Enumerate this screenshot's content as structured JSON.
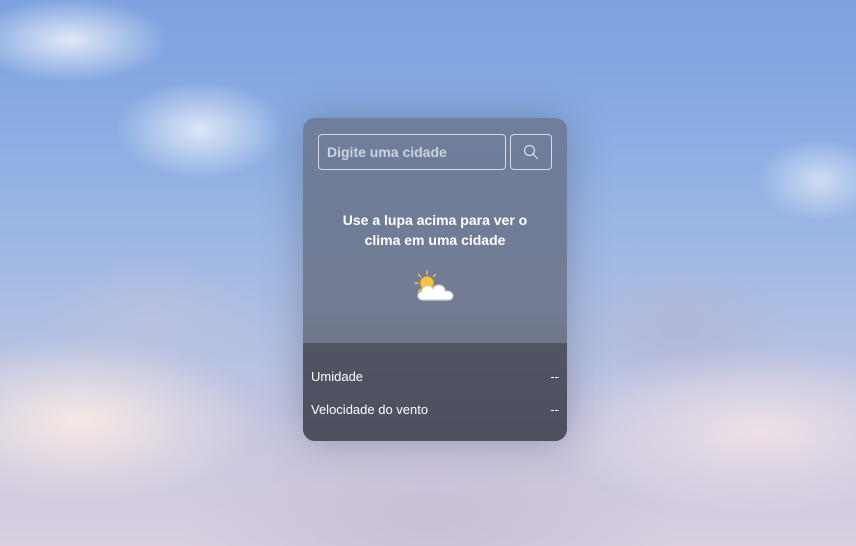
{
  "search": {
    "placeholder": "Digite uma cidade",
    "value": "",
    "button_icon": "search-icon"
  },
  "message": {
    "line1": "Use a lupa acima para ver o",
    "line2": "clima em uma cidade"
  },
  "weather": {
    "icon": "partly-cloudy-icon"
  },
  "details": [
    {
      "label": "Umidade",
      "value": "--"
    },
    {
      "label": "Velocidade do vento",
      "value": "--"
    }
  ],
  "colors": {
    "card_background": "#646c80",
    "details_background": "#484a58",
    "text": "#ffffff",
    "sun": "#f5c542",
    "cloud": "#ffffff"
  }
}
